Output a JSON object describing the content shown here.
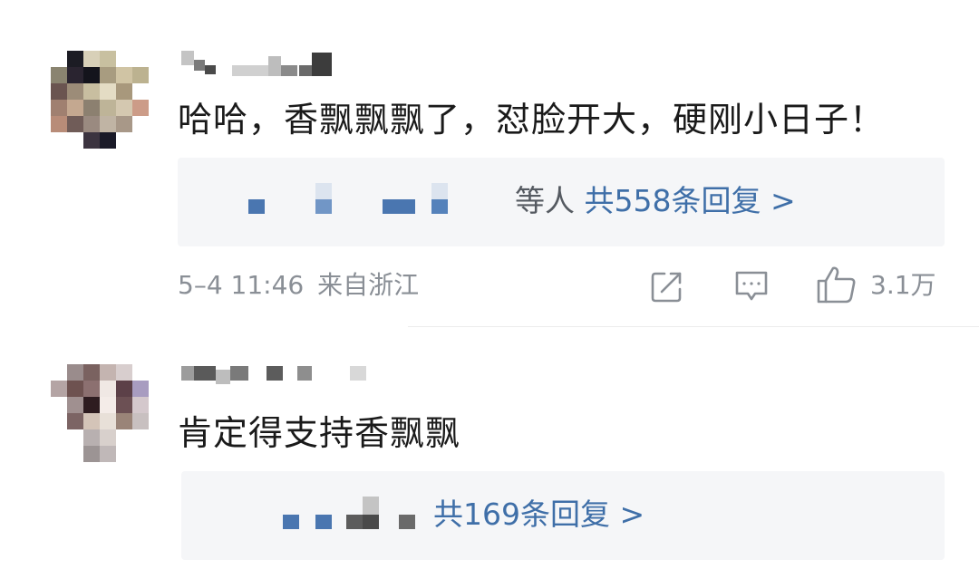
{
  "comments": [
    {
      "text": "哈哈，香飘飘飘了，怼脸开大，硬刚小日子！",
      "replies": {
        "who_label": "等人",
        "count_label": "共558条回复 >"
      },
      "timestamp": "5–4 11:46",
      "location": "来自浙江",
      "like_count": "3.1万",
      "icons": [
        "share-icon",
        "comment-icon",
        "like-icon"
      ]
    },
    {
      "text": "肯定得支持香飘飘",
      "replies": {
        "count_label": "共169条回复 >"
      }
    }
  ],
  "colors": {
    "reply_link": "#3f6fa8",
    "meta_gray": "#8a8f96",
    "reply_bg": "#f5f6f8"
  }
}
